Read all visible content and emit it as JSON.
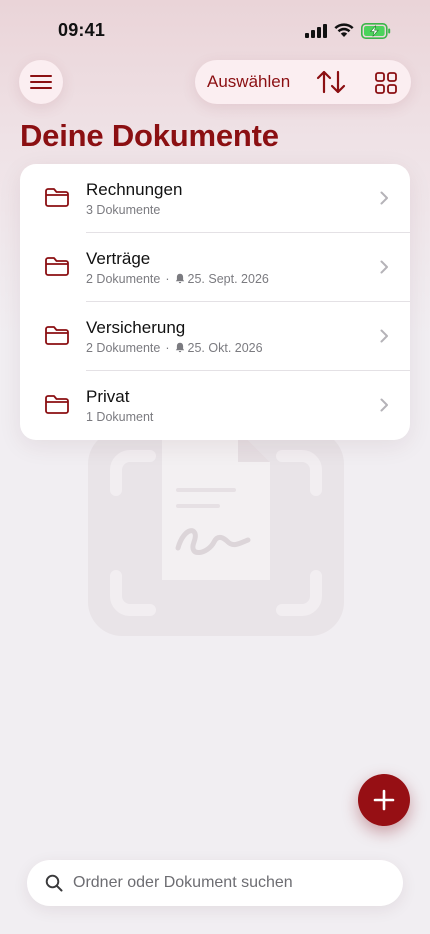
{
  "status_bar": {
    "time": "09:41"
  },
  "header": {
    "select_label": "Auswählen",
    "title": "Deine Dokumente",
    "menu_icon": "hamburger-menu-icon",
    "sort_icon": "sort-arrows-icon",
    "grid_icon": "grid-view-icon"
  },
  "folders": [
    {
      "name": "Rechnungen",
      "count": "3 Dokumente",
      "reminder": ""
    },
    {
      "name": "Verträge",
      "count": "2 Dokumente",
      "reminder": "25. Sept. 2026"
    },
    {
      "name": "Versicherung",
      "count": "2 Dokumente",
      "reminder": "25. Okt. 2026"
    },
    {
      "name": "Privat",
      "count": "1 Dokument",
      "reminder": ""
    }
  ],
  "search": {
    "placeholder": "Ordner oder Dokument suchen"
  },
  "fab": {
    "icon": "plus-icon"
  },
  "colors": {
    "accent": "#8b0f12",
    "fab": "#960f14",
    "background": "#f1eef2"
  }
}
